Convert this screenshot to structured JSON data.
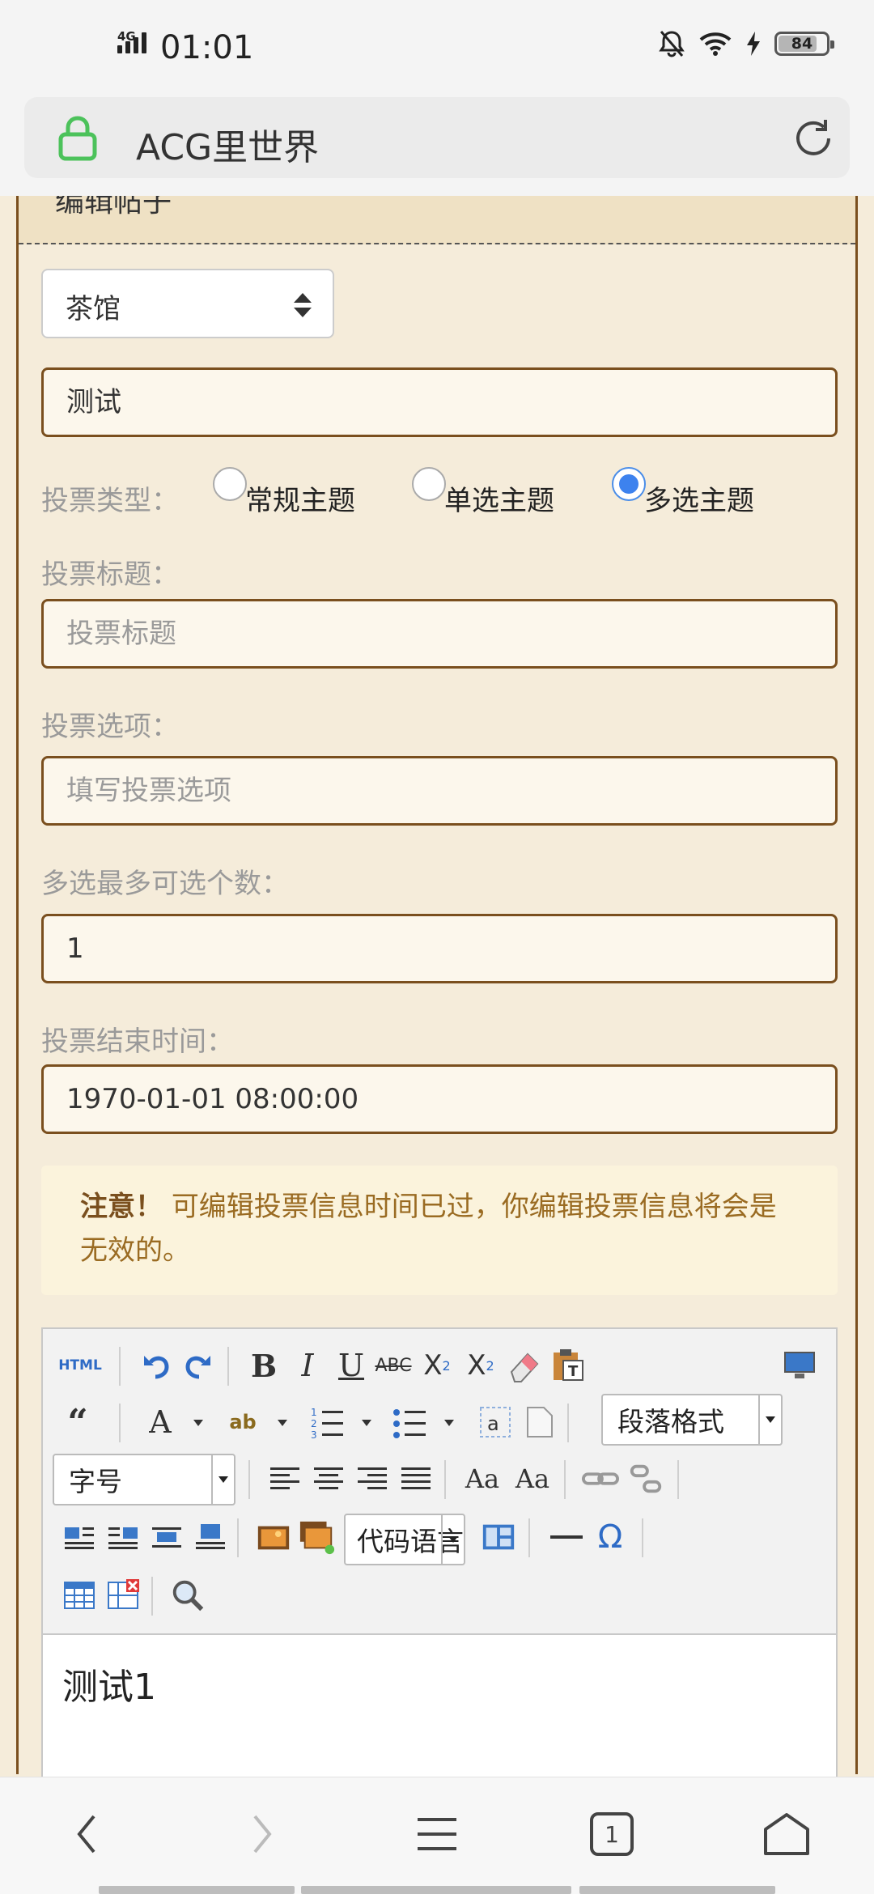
{
  "status_bar": {
    "network": "4G",
    "time": "01:01",
    "battery": "84",
    "icons": [
      "signal-icon",
      "mute-bell-icon",
      "wifi-icon",
      "charging-icon",
      "battery-icon"
    ]
  },
  "url_bar": {
    "title": "ACG里世界",
    "icons": [
      "lock-icon",
      "reload-icon"
    ]
  },
  "panel": {
    "title": "编辑帖子"
  },
  "form": {
    "category_selected": "茶馆",
    "title_value": "测试",
    "vote_type_label": "投票类型：",
    "vote_options": [
      {
        "label": "常规主题",
        "checked": false
      },
      {
        "label": "单选主题",
        "checked": false
      },
      {
        "label": "多选主题",
        "checked": true
      }
    ],
    "vote_title_label": "投票标题：",
    "vote_title_placeholder": "投票标题",
    "vote_items_label": "投票选项：",
    "vote_items_placeholder": "填写投票选项",
    "multi_max_label": "多选最多可选个数：",
    "multi_max_value": "1",
    "end_time_label": "投票结束时间：",
    "end_time_value": "1970-01-01 08:00:00"
  },
  "notice": {
    "strong": "注意！",
    "text": "可编辑投票信息时间已过，你编辑投票信息将会是无效的。"
  },
  "editor": {
    "toolbar": {
      "html_label": "HTML",
      "paragraph_format": "段落格式",
      "font_size": "字号",
      "code_language": "代码语言"
    },
    "content": "测试1"
  },
  "bottom_nav": {
    "tab_count": "1",
    "icons": [
      "back-icon",
      "forward-icon",
      "menu-icon",
      "tabs-icon",
      "home-icon"
    ]
  },
  "colors": {
    "page_bg": "#f5ecda",
    "accent_brown": "#7a4f1e",
    "radio_blue": "#3d82ee",
    "notice_text": "#9a6b22",
    "lock_green": "#4cc25b"
  }
}
